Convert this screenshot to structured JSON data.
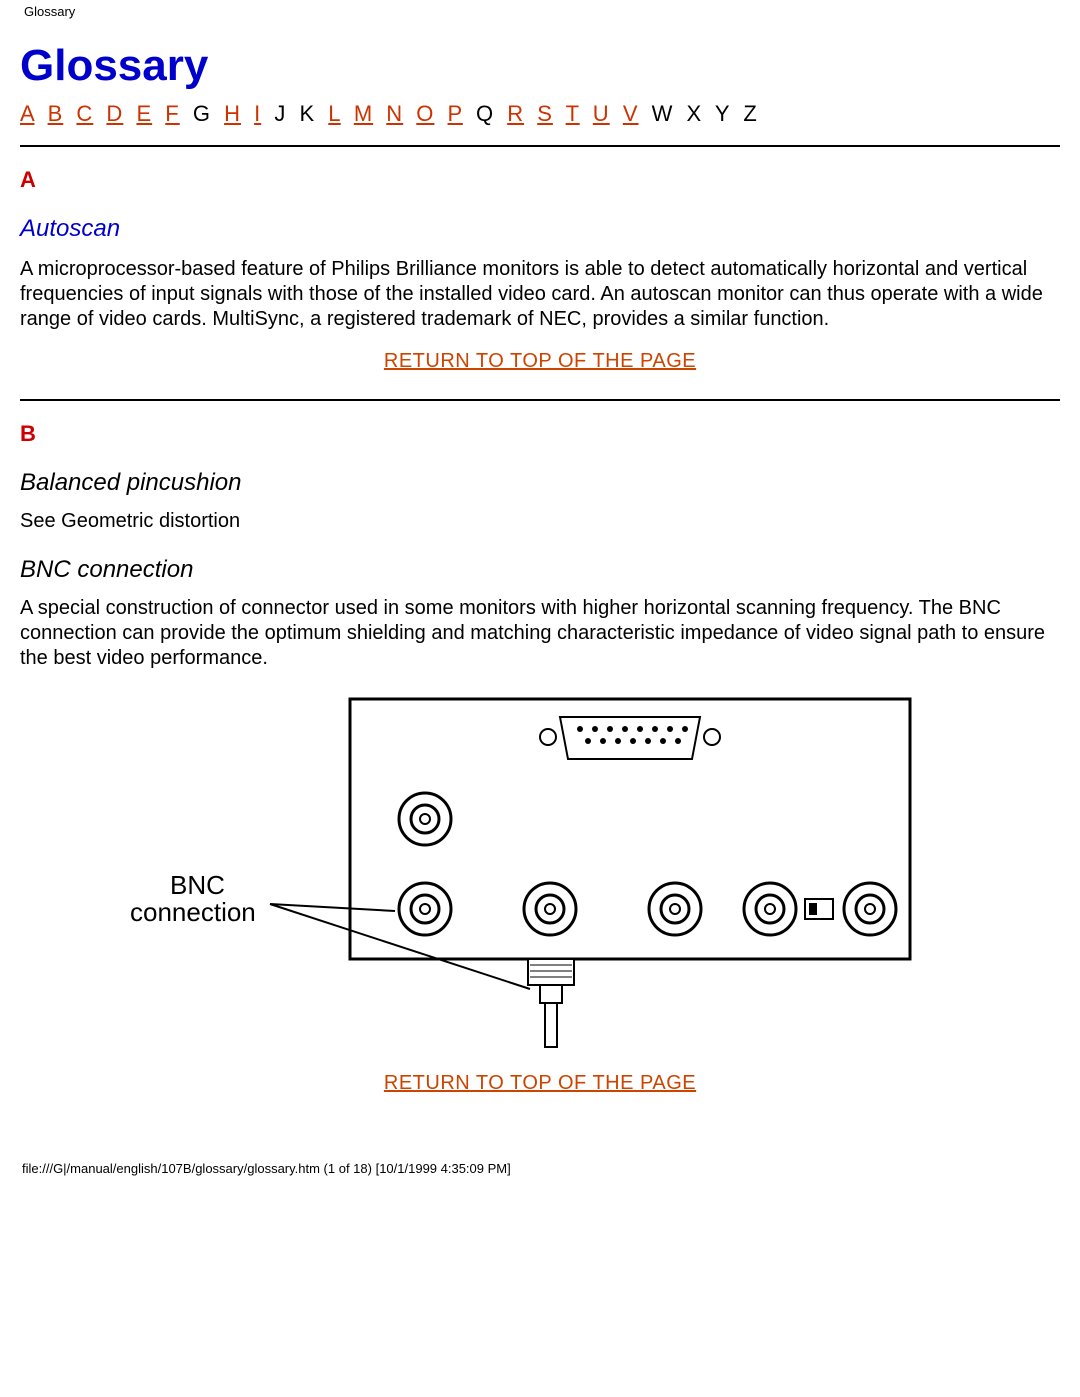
{
  "header": {
    "label": "Glossary"
  },
  "title": "Glossary",
  "index": [
    {
      "t": "A",
      "link": true
    },
    {
      "t": "B",
      "link": true
    },
    {
      "t": "C",
      "link": true
    },
    {
      "t": "D",
      "link": true
    },
    {
      "t": "E",
      "link": true
    },
    {
      "t": "F",
      "link": true
    },
    {
      "t": "G",
      "link": false
    },
    {
      "t": "H",
      "link": true
    },
    {
      "t": "I",
      "link": true
    },
    {
      "t": "J",
      "link": false
    },
    {
      "t": "K",
      "link": false
    },
    {
      "t": "L",
      "link": true
    },
    {
      "t": "M",
      "link": true
    },
    {
      "t": "N",
      "link": true
    },
    {
      "t": "O",
      "link": true
    },
    {
      "t": "P",
      "link": true
    },
    {
      "t": "Q",
      "link": false
    },
    {
      "t": "R",
      "link": true
    },
    {
      "t": "S",
      "link": true
    },
    {
      "t": "T",
      "link": true
    },
    {
      "t": "U",
      "link": true
    },
    {
      "t": "V",
      "link": true
    },
    {
      "t": "W",
      "link": false
    },
    {
      "t": "X",
      "link": false
    },
    {
      "t": "Y",
      "link": false
    },
    {
      "t": "Z",
      "link": false
    }
  ],
  "sections": {
    "A": {
      "letter": "A",
      "term": "Autoscan",
      "body": "A microprocessor-based feature of Philips Brilliance monitors is able to detect automatically horizontal and vertical frequencies of input signals with those of the installed video card. An autoscan monitor can thus operate with a wide range of video cards. MultiSync, a registered trademark of NEC, provides a similar function."
    },
    "B": {
      "letter": "B",
      "term1": "Balanced pincushion",
      "body1": "See Geometric distortion",
      "term2": "BNC connection",
      "body2": "A special construction of connector used in some monitors with higher horizontal scanning frequency. The BNC connection can provide the optimum shielding and matching characteristic impedance of video signal path to ensure the best video performance."
    }
  },
  "diagram": {
    "label_line1": "BNC",
    "label_line2": "connection"
  },
  "return_link": "RETURN TO TOP OF THE PAGE",
  "footer": "file:///G|/manual/english/107B/glossary/glossary.htm (1 of 18) [10/1/1999 4:35:09 PM]"
}
